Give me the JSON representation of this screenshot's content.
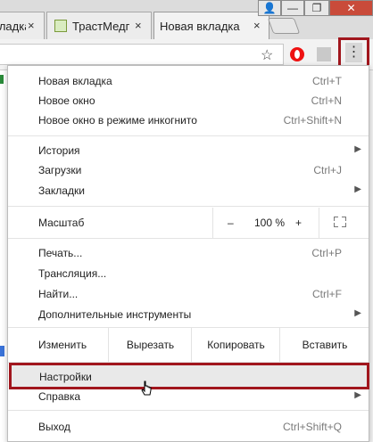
{
  "tabs": [
    {
      "label": "кладка",
      "close": "×"
    },
    {
      "label": "ТрастМедг",
      "close": "×"
    },
    {
      "label": "Новая вкладка",
      "close": "×",
      "active": true
    }
  ],
  "window_buttons": {
    "user": "👤",
    "minimize": "—",
    "maximize": "❐",
    "close": "✕"
  },
  "toolbar": {
    "star": "☆",
    "menu": "⋮"
  },
  "menu": {
    "group1": [
      {
        "label": "Новая вкладка",
        "shortcut": "Ctrl+T"
      },
      {
        "label": "Новое окно",
        "shortcut": "Ctrl+N"
      },
      {
        "label": "Новое окно в режиме инкогнито",
        "shortcut": "Ctrl+Shift+N"
      }
    ],
    "group2": [
      {
        "label": "История",
        "shortcut": ""
      },
      {
        "label": "Загрузки",
        "shortcut": "Ctrl+J"
      },
      {
        "label": "Закладки",
        "shortcut": ""
      }
    ],
    "zoom": {
      "label": "Масштаб",
      "minus": "–",
      "value": "100 %",
      "plus": "+"
    },
    "group3": [
      {
        "label": "Печать...",
        "shortcut": "Ctrl+P"
      },
      {
        "label": "Трансляция...",
        "shortcut": ""
      },
      {
        "label": "Найти...",
        "shortcut": "Ctrl+F"
      },
      {
        "label": "Дополнительные инструменты",
        "shortcut": ""
      }
    ],
    "edit": {
      "label": "Изменить",
      "cut": "Вырезать",
      "copy": "Копировать",
      "paste": "Вставить"
    },
    "settings": {
      "label": "Настройки"
    },
    "help": {
      "label": "Справка"
    },
    "exit": {
      "label": "Выход",
      "shortcut": "Ctrl+Shift+Q"
    },
    "submenu_arrow": "▶"
  },
  "colors": {
    "highlight_border": "#a1161d",
    "opera_red": "#e11111"
  }
}
